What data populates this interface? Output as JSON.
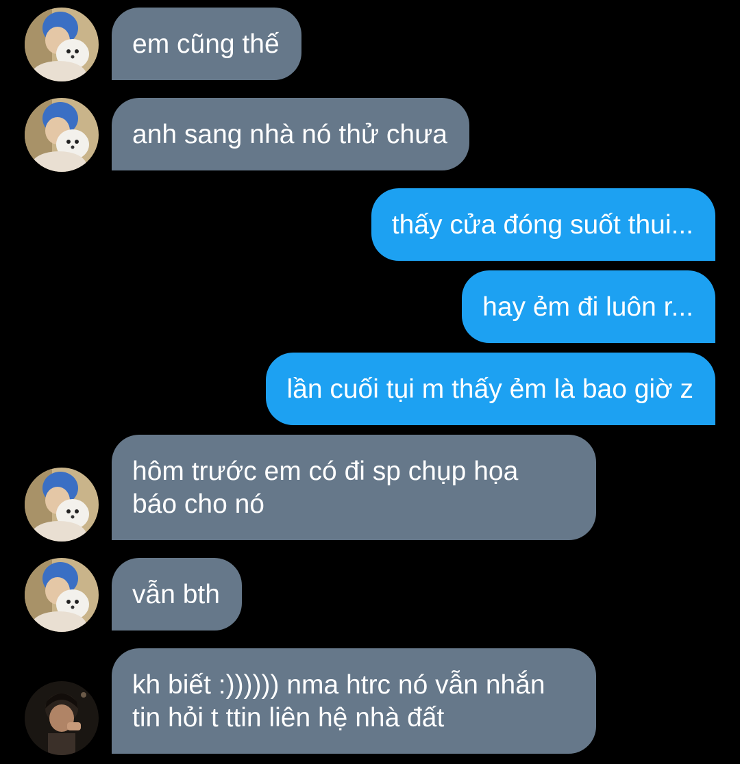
{
  "conversation": {
    "messages": [
      {
        "direction": "received",
        "text": "em cũng thế",
        "avatar": "user-a-avatar"
      },
      {
        "direction": "received",
        "text": "anh sang nhà nó thử chưa",
        "avatar": "user-a-avatar"
      },
      {
        "direction": "sent",
        "text": "thấy cửa đóng suốt thui..."
      },
      {
        "direction": "sent",
        "text": "hay ẻm đi luôn r..."
      },
      {
        "direction": "sent",
        "text": "lần cuối tụi m thấy ẻm là bao giờ z"
      },
      {
        "direction": "received",
        "text": "hôm trước em có đi sp chụp họa\nbáo cho nó",
        "avatar": "user-a-avatar"
      },
      {
        "direction": "received",
        "text": "vẫn bth",
        "avatar": "user-a-avatar"
      },
      {
        "direction": "received",
        "text": "kh biết :)))))) nma htrc nó vẫn nhắn\ntin hỏi t ttin liên hệ nhà đất",
        "avatar": "user-b-avatar"
      }
    ]
  },
  "colors": {
    "background": "#000000",
    "received_bubble": "#66788a",
    "sent_bubble": "#1da1f2",
    "text": "#ffffff"
  }
}
